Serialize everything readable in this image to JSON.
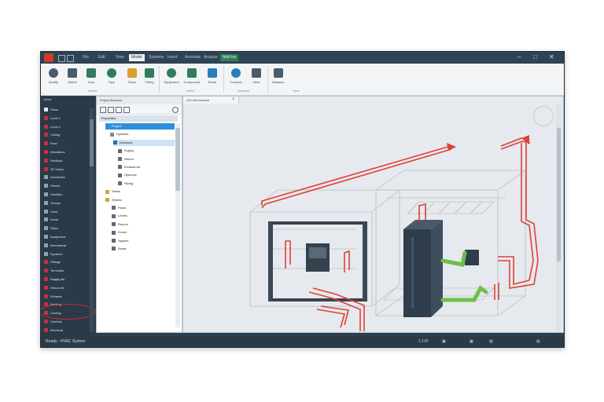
{
  "titlebar": {
    "tabs": [
      {
        "label": "File"
      },
      {
        "label": "Edit"
      },
      {
        "label": "View"
      },
      {
        "label": "Model"
      },
      {
        "label": "Systems"
      },
      {
        "label": "Insert"
      },
      {
        "label": "Annotate"
      },
      {
        "label": "Analyze"
      },
      {
        "label": "Add-Ins"
      }
    ],
    "controls": [
      "–",
      "□",
      "✕"
    ]
  },
  "ribbon": {
    "buttons": [
      {
        "label": "Modify",
        "icon": "cursor-icon",
        "color": "#4a5b6b"
      },
      {
        "label": "Select",
        "icon": "select-icon",
        "color": "#4a5b6b"
      },
      {
        "label": "Duct",
        "icon": "duct-icon",
        "color": "#2f7d5a"
      },
      {
        "label": "Pipe",
        "icon": "pipe-icon",
        "color": "#2f7d5a"
      },
      {
        "label": "Place",
        "icon": "place-icon",
        "color": "#d8a02a"
      },
      {
        "label": "Fitting",
        "icon": "fitting-icon",
        "color": "#2f7d5a"
      },
      {
        "label": "Equipment",
        "icon": "equipment-icon",
        "color": "#2f7d5a"
      },
      {
        "label": "Component",
        "icon": "component-icon",
        "color": "#2f7d5a"
      },
      {
        "label": "Route",
        "icon": "route-icon",
        "color": "#2a7db8"
      },
      {
        "label": "Connect",
        "icon": "connect-icon",
        "color": "#2a7db8"
      },
      {
        "label": "View",
        "icon": "view-icon",
        "color": "#4a5b6b"
      },
      {
        "label": "Measure",
        "icon": "measure-icon",
        "color": "#4a5b6b"
      }
    ],
    "groups": [
      "Select",
      "HVAC",
      "Systems",
      "View"
    ]
  },
  "nav": {
    "header": "Views",
    "items": [
      {
        "label": "Plans",
        "color": "#e0e6ec"
      },
      {
        "label": "Level 1",
        "color": "#c2313a"
      },
      {
        "label": "Level 2",
        "color": "#c2313a"
      },
      {
        "label": "Ceiling",
        "color": "#c2313a"
      },
      {
        "label": "Roof",
        "color": "#c2313a"
      },
      {
        "label": "Elevations",
        "color": "#c2313a"
      },
      {
        "label": "Sections",
        "color": "#c2313a"
      },
      {
        "label": "3D Views",
        "color": "#c2313a"
      },
      {
        "label": "Schedules",
        "color": "#8fa2b3"
      },
      {
        "label": "Sheets",
        "color": "#8fa2b3"
      },
      {
        "label": "Families",
        "color": "#8fa2b3"
      },
      {
        "label": "Groups",
        "color": "#8fa2b3"
      },
      {
        "label": "Links",
        "color": "#8fa2b3"
      },
      {
        "label": "Ducts",
        "color": "#8fa2b3"
      },
      {
        "label": "Pipes",
        "color": "#8fa2b3"
      },
      {
        "label": "Equipment",
        "color": "#8fa2b3"
      },
      {
        "label": "Mechanical",
        "color": "#8fa2b3"
      },
      {
        "label": "Systems",
        "color": "#8fa2b3"
      },
      {
        "label": "Fittings",
        "color": "#c2313a"
      },
      {
        "label": "Terminals",
        "color": "#c2313a"
      },
      {
        "label": "Supply Air",
        "color": "#c2313a"
      },
      {
        "label": "Return Air",
        "color": "#c2313a"
      },
      {
        "label": "Exhaust",
        "color": "#c2313a"
      },
      {
        "label": "Heating",
        "color": "#c2313a"
      },
      {
        "label": "Cooling",
        "color": "#c2313a"
      },
      {
        "label": "Controls",
        "color": "#c2313a"
      },
      {
        "label": "Electrical",
        "color": "#c2313a"
      }
    ]
  },
  "tree": {
    "title": "Project Browser",
    "header": "Properties",
    "items": [
      {
        "label": "Project",
        "indent": 8,
        "state": "sel",
        "icon": "#2f8fdc"
      },
      {
        "label": "Systems",
        "indent": 14,
        "state": "",
        "icon": "#7c8a97"
      },
      {
        "label": "Ductwork",
        "indent": 18,
        "state": "sel2",
        "icon": "#2f6fb0"
      },
      {
        "label": "Supply",
        "indent": 24,
        "state": "",
        "icon": "#5c6b78"
      },
      {
        "label": "Return",
        "indent": 24,
        "state": "",
        "icon": "#5c6b78"
      },
      {
        "label": "Exhaust Air",
        "indent": 24,
        "state": "",
        "icon": "#5c6b78"
      },
      {
        "label": "Hydronic",
        "indent": 24,
        "state": "",
        "icon": "#5c6b78"
      },
      {
        "label": "Piping",
        "indent": 24,
        "state": "",
        "icon": "#5c6b78"
      },
      {
        "label": "Views",
        "indent": 8,
        "state": "",
        "icon": "#d7a23c"
      },
      {
        "label": "Sheets",
        "indent": 8,
        "state": "",
        "icon": "#d7a23c"
      },
      {
        "label": "Plans",
        "indent": 16,
        "state": "",
        "icon": "#5c6b78"
      },
      {
        "label": "Levels",
        "indent": 16,
        "state": "",
        "icon": "#5c6b78"
      },
      {
        "label": "Rooms",
        "indent": 16,
        "state": "",
        "icon": "#5c6b78"
      },
      {
        "label": "Zones",
        "indent": 16,
        "state": "",
        "icon": "#5c6b78"
      },
      {
        "label": "Spaces",
        "indent": 16,
        "state": "",
        "icon": "#5c6b78"
      },
      {
        "label": "Areas",
        "indent": 16,
        "state": "",
        "icon": "#5c6b78"
      }
    ]
  },
  "viewport": {
    "tab_label": "{3D} Mechanical",
    "close": "×"
  },
  "status": {
    "text": "Ready - HVAC System",
    "right": [
      "1:100",
      "▣",
      "▦",
      "▧",
      "▤"
    ]
  },
  "colors": {
    "duct_red": "#e0413a",
    "pipe_green": "#6cc04a",
    "equipment_dark": "#2f3e4e"
  }
}
